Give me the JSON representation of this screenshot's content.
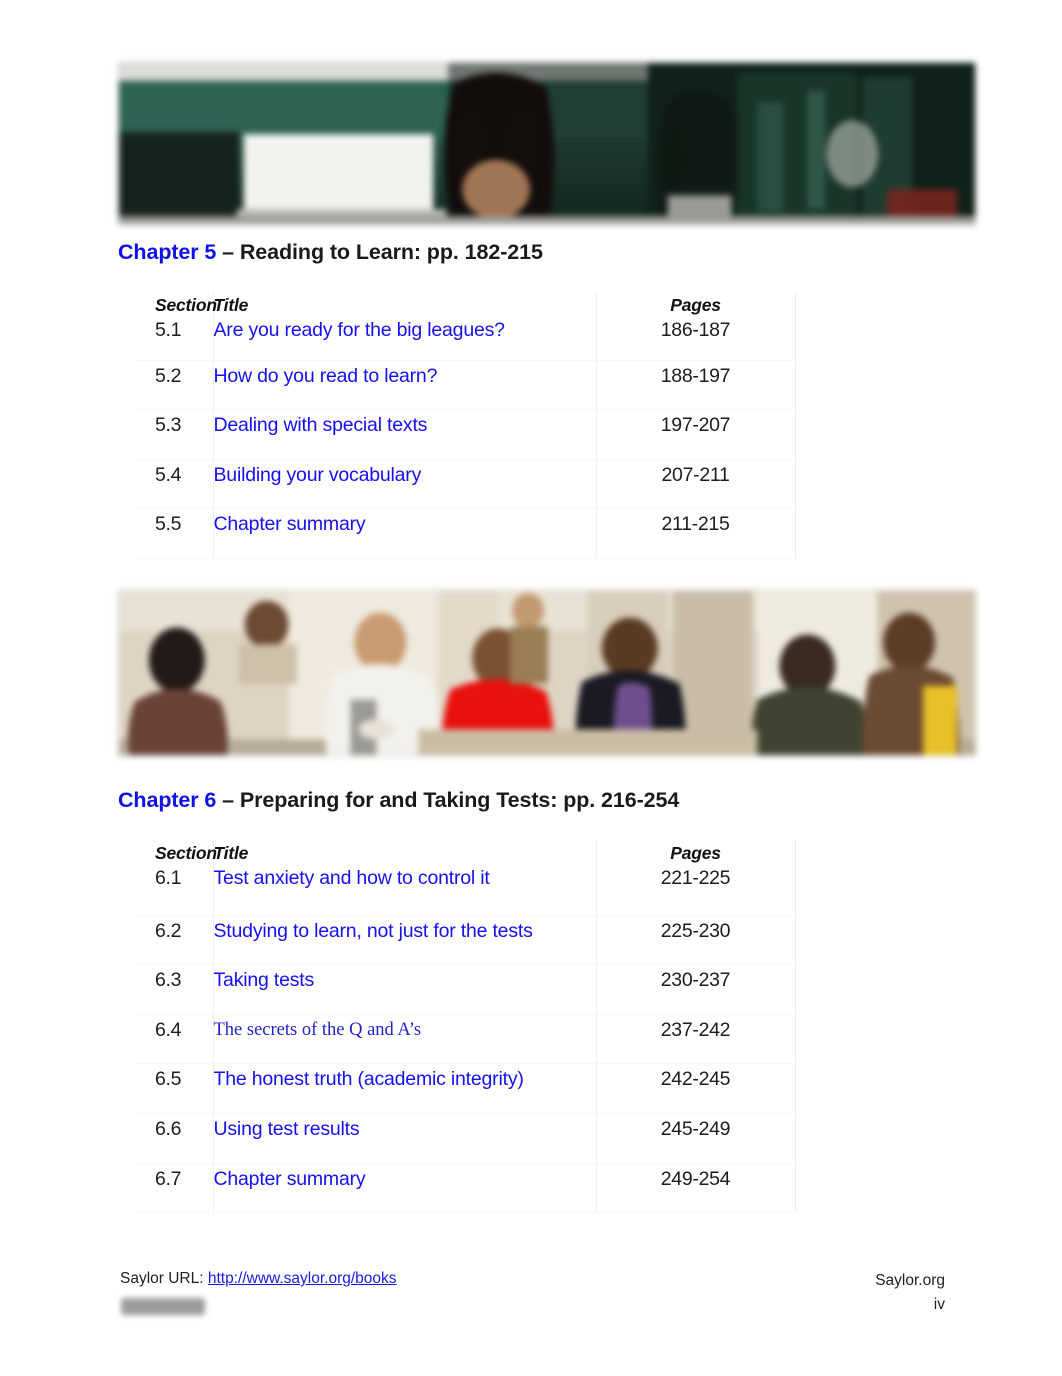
{
  "document": {
    "page_number": "iv",
    "site_name": "Saylor.org"
  },
  "banners": [
    {
      "name": "students-with-laptop-chalkboard",
      "alt": "Blurred photo of students at a laptop in front of a dark green chalkboard"
    },
    {
      "name": "students-group-study",
      "alt": "Blurred photo of a group of students studying together in a classroom"
    }
  ],
  "chapters": [
    {
      "label": "Chapter 5",
      "separator": " – ",
      "title_and_pages": "Reading to Learn: pp. 182-215",
      "table": {
        "headers": {
          "section": "Section",
          "title": "Title",
          "pages": "Pages"
        },
        "rows": [
          {
            "section": "5.1",
            "title": "Are you ready for the big leagues?",
            "pages": "186-187"
          },
          {
            "section": "5.2",
            "title": "How do you read to learn?",
            "pages": "188-197"
          },
          {
            "section": "5.3",
            "title": "Dealing with special texts",
            "pages": "197-207"
          },
          {
            "section": "5.4",
            "title": "Building your vocabulary",
            "pages": "207-211"
          },
          {
            "section": "5.5",
            "title": "Chapter summary",
            "pages": "211-215"
          }
        ]
      }
    },
    {
      "label": "Chapter 6",
      "separator": " – ",
      "title_and_pages": "Preparing for and Taking Tests: pp. 216-254",
      "table": {
        "headers": {
          "section": "Section",
          "title": "Title",
          "pages": "Pages"
        },
        "rows": [
          {
            "section": "6.1",
            "title": "Test anxiety and how to control it",
            "pages": "221-225"
          },
          {
            "section": "6.2",
            "title": "Studying to learn, not just for the tests",
            "pages": "225-230"
          },
          {
            "section": "6.3",
            "title": "Taking tests",
            "pages": "230-237"
          },
          {
            "section": "6.4",
            "title": "The secrets of the Q and A’s",
            "pages": "237-242",
            "serif": true
          },
          {
            "section": "6.5",
            "title": "The honest truth (academic integrity)",
            "pages": "242-245"
          },
          {
            "section": "6.6",
            "title": "Using test results",
            "pages": "245-249"
          },
          {
            "section": "6.7",
            "title": "Chapter summary",
            "pages": "249-254"
          }
        ]
      }
    }
  ],
  "footer": {
    "url_label": "Saylor URL: ",
    "url": "http://www.saylor.org/books",
    "site_name": "Saylor.org",
    "page_number": "iv"
  },
  "colors": {
    "link_blue": "#1510f0",
    "heading_blue": "#1010e8",
    "heading_highlight": "#dfe2f4",
    "text_black": "#1c1c1c"
  }
}
